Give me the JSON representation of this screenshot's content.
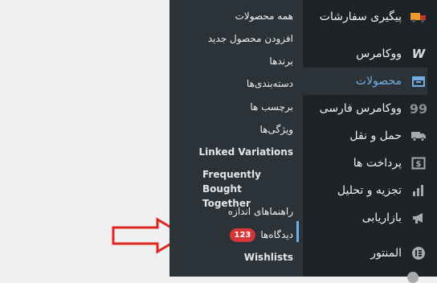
{
  "submenu": {
    "items": [
      {
        "label": "همه محصولات"
      },
      {
        "label": "افزودن محصول جدید"
      },
      {
        "label": "برندها"
      },
      {
        "label": "دسته‌بندی‌ها"
      },
      {
        "label": "برچسب ها"
      },
      {
        "label": "ویژگی‌ها"
      },
      {
        "label": "Linked Variations"
      },
      {
        "label": "Frequently Bought\nTogether"
      },
      {
        "label": "راهنماهای اندازه"
      },
      {
        "label": "دیدگاه‌ها",
        "badge": "123"
      },
      {
        "label": "Wishlists"
      }
    ]
  },
  "admin_menu": {
    "items": [
      {
        "label": "پیگیری سفارشات",
        "icon": "truck-icon"
      },
      {
        "label": "ووکامرس",
        "icon": "woocommerce-icon"
      },
      {
        "label": "محصولات",
        "icon": "archive-box-icon"
      },
      {
        "label": "ووکامرس فارسی",
        "icon": "quote-icon"
      },
      {
        "label": "حمل و نقل",
        "icon": "truck-icon"
      },
      {
        "label": "پرداخت ها",
        "icon": "dollar-icon"
      },
      {
        "label": "تجزیه و تحلیل",
        "icon": "bar-chart-icon"
      },
      {
        "label": "بازاریابی",
        "icon": "megaphone-icon"
      },
      {
        "label": "المنتور",
        "icon": "elementor-icon"
      }
    ]
  },
  "colors": {
    "menu_bg": "#1d2327",
    "submenu_bg": "#2c3338",
    "accent": "#72aee6",
    "badge": "#d63638",
    "arrow": "#e0241f"
  }
}
